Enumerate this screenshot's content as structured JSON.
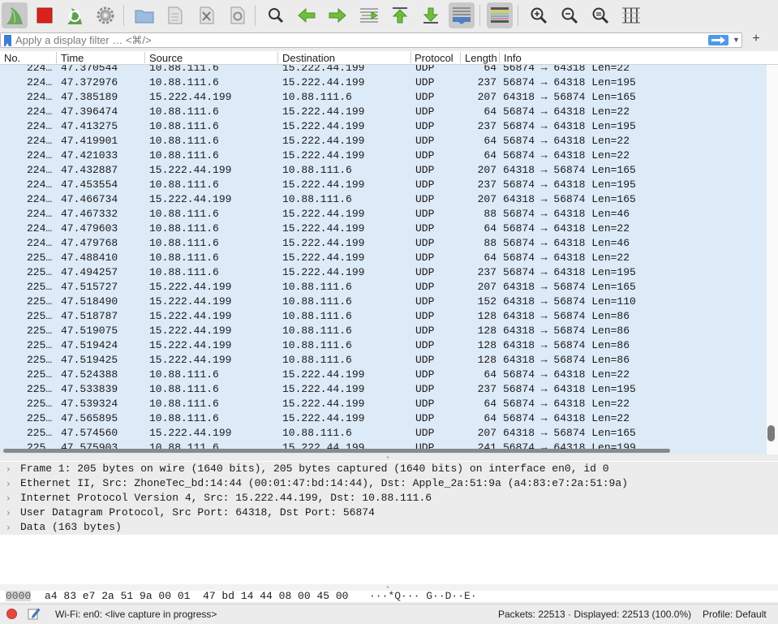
{
  "filter": {
    "placeholder": "Apply a display filter … <⌘/>",
    "add_label": "+"
  },
  "columns": [
    "No.",
    "Time",
    "Source",
    "Destination",
    "Protocol",
    "Length",
    "Info"
  ],
  "packets": [
    {
      "no": "224…",
      "time": "47.370544",
      "src": "10.88.111.6",
      "dst": "15.222.44.199",
      "proto": "UDP",
      "len": "64",
      "info": "56874 → 64318 Len=22"
    },
    {
      "no": "224…",
      "time": "47.372976",
      "src": "10.88.111.6",
      "dst": "15.222.44.199",
      "proto": "UDP",
      "len": "237",
      "info": "56874 → 64318 Len=195"
    },
    {
      "no": "224…",
      "time": "47.385189",
      "src": "15.222.44.199",
      "dst": "10.88.111.6",
      "proto": "UDP",
      "len": "207",
      "info": "64318 → 56874 Len=165"
    },
    {
      "no": "224…",
      "time": "47.396474",
      "src": "10.88.111.6",
      "dst": "15.222.44.199",
      "proto": "UDP",
      "len": "64",
      "info": "56874 → 64318 Len=22"
    },
    {
      "no": "224…",
      "time": "47.413275",
      "src": "10.88.111.6",
      "dst": "15.222.44.199",
      "proto": "UDP",
      "len": "237",
      "info": "56874 → 64318 Len=195"
    },
    {
      "no": "224…",
      "time": "47.419901",
      "src": "10.88.111.6",
      "dst": "15.222.44.199",
      "proto": "UDP",
      "len": "64",
      "info": "56874 → 64318 Len=22"
    },
    {
      "no": "224…",
      "time": "47.421033",
      "src": "10.88.111.6",
      "dst": "15.222.44.199",
      "proto": "UDP",
      "len": "64",
      "info": "56874 → 64318 Len=22"
    },
    {
      "no": "224…",
      "time": "47.432887",
      "src": "15.222.44.199",
      "dst": "10.88.111.6",
      "proto": "UDP",
      "len": "207",
      "info": "64318 → 56874 Len=165"
    },
    {
      "no": "224…",
      "time": "47.453554",
      "src": "10.88.111.6",
      "dst": "15.222.44.199",
      "proto": "UDP",
      "len": "237",
      "info": "56874 → 64318 Len=195"
    },
    {
      "no": "224…",
      "time": "47.466734",
      "src": "15.222.44.199",
      "dst": "10.88.111.6",
      "proto": "UDP",
      "len": "207",
      "info": "64318 → 56874 Len=165"
    },
    {
      "no": "224…",
      "time": "47.467332",
      "src": "10.88.111.6",
      "dst": "15.222.44.199",
      "proto": "UDP",
      "len": "88",
      "info": "56874 → 64318 Len=46"
    },
    {
      "no": "224…",
      "time": "47.479603",
      "src": "10.88.111.6",
      "dst": "15.222.44.199",
      "proto": "UDP",
      "len": "64",
      "info": "56874 → 64318 Len=22"
    },
    {
      "no": "224…",
      "time": "47.479768",
      "src": "10.88.111.6",
      "dst": "15.222.44.199",
      "proto": "UDP",
      "len": "88",
      "info": "56874 → 64318 Len=46"
    },
    {
      "no": "225…",
      "time": "47.488410",
      "src": "10.88.111.6",
      "dst": "15.222.44.199",
      "proto": "UDP",
      "len": "64",
      "info": "56874 → 64318 Len=22"
    },
    {
      "no": "225…",
      "time": "47.494257",
      "src": "10.88.111.6",
      "dst": "15.222.44.199",
      "proto": "UDP",
      "len": "237",
      "info": "56874 → 64318 Len=195"
    },
    {
      "no": "225…",
      "time": "47.515727",
      "src": "15.222.44.199",
      "dst": "10.88.111.6",
      "proto": "UDP",
      "len": "207",
      "info": "64318 → 56874 Len=165"
    },
    {
      "no": "225…",
      "time": "47.518490",
      "src": "15.222.44.199",
      "dst": "10.88.111.6",
      "proto": "UDP",
      "len": "152",
      "info": "64318 → 56874 Len=110"
    },
    {
      "no": "225…",
      "time": "47.518787",
      "src": "15.222.44.199",
      "dst": "10.88.111.6",
      "proto": "UDP",
      "len": "128",
      "info": "64318 → 56874 Len=86"
    },
    {
      "no": "225…",
      "time": "47.519075",
      "src": "15.222.44.199",
      "dst": "10.88.111.6",
      "proto": "UDP",
      "len": "128",
      "info": "64318 → 56874 Len=86"
    },
    {
      "no": "225…",
      "time": "47.519424",
      "src": "15.222.44.199",
      "dst": "10.88.111.6",
      "proto": "UDP",
      "len": "128",
      "info": "64318 → 56874 Len=86"
    },
    {
      "no": "225…",
      "time": "47.519425",
      "src": "15.222.44.199",
      "dst": "10.88.111.6",
      "proto": "UDP",
      "len": "128",
      "info": "64318 → 56874 Len=86"
    },
    {
      "no": "225…",
      "time": "47.524388",
      "src": "10.88.111.6",
      "dst": "15.222.44.199",
      "proto": "UDP",
      "len": "64",
      "info": "56874 → 64318 Len=22"
    },
    {
      "no": "225…",
      "time": "47.533839",
      "src": "10.88.111.6",
      "dst": "15.222.44.199",
      "proto": "UDP",
      "len": "237",
      "info": "56874 → 64318 Len=195"
    },
    {
      "no": "225…",
      "time": "47.539324",
      "src": "10.88.111.6",
      "dst": "15.222.44.199",
      "proto": "UDP",
      "len": "64",
      "info": "56874 → 64318 Len=22"
    },
    {
      "no": "225…",
      "time": "47.565895",
      "src": "10.88.111.6",
      "dst": "15.222.44.199",
      "proto": "UDP",
      "len": "64",
      "info": "56874 → 64318 Len=22"
    },
    {
      "no": "225…",
      "time": "47.574560",
      "src": "15.222.44.199",
      "dst": "10.88.111.6",
      "proto": "UDP",
      "len": "207",
      "info": "64318 → 56874 Len=165"
    },
    {
      "no": "225…",
      "time": "47.575903",
      "src": "10.88.111.6",
      "dst": "15.222.44.199",
      "proto": "UDP",
      "len": "241",
      "info": "56874 → 64318 Len=199"
    }
  ],
  "details": [
    "Frame 1: 205 bytes on wire (1640 bits), 205 bytes captured (1640 bits) on interface en0, id 0",
    "Ethernet II, Src: ZhoneTec_bd:14:44 (00:01:47:bd:14:44), Dst: Apple_2a:51:9a (a4:83:e7:2a:51:9a)",
    "Internet Protocol Version 4, Src: 15.222.44.199, Dst: 10.88.111.6",
    "User Datagram Protocol, Src Port: 64318, Dst Port: 56874",
    "Data (163 bytes)"
  ],
  "bytes": {
    "offset": "0000",
    "hex": "a4 83 e7 2a 51 9a 00 01  47 bd 14 44 08 00 45 00",
    "ascii": "···*Q··· G··D··E·"
  },
  "status": {
    "capture_text": "Wi-Fi: en0: <live capture in progress>",
    "packets_text": "Packets: 22513 · Displayed: 22513 (100.0%)",
    "profile_text": "Profile: Default"
  },
  "colors": {
    "selected_row": "#ddeaf8",
    "accent": "#4f9ae8",
    "record": "#e5483f"
  },
  "toolbar_icons": [
    "shark-fin-start-icon",
    "stop-square-icon",
    "restart-capture-icon",
    "capture-options-gear-icon",
    "open-folder-icon",
    "save-file-icon",
    "close-file-icon",
    "reload-file-icon",
    "find-packet-icon",
    "go-back-arrow-icon",
    "go-forward-arrow-icon",
    "go-to-packet-icon",
    "first-packet-icon",
    "last-packet-icon",
    "autoscroll-icon",
    "colorize-icon",
    "zoom-in-icon",
    "zoom-out-icon",
    "normal-size-icon",
    "resize-columns-icon"
  ]
}
